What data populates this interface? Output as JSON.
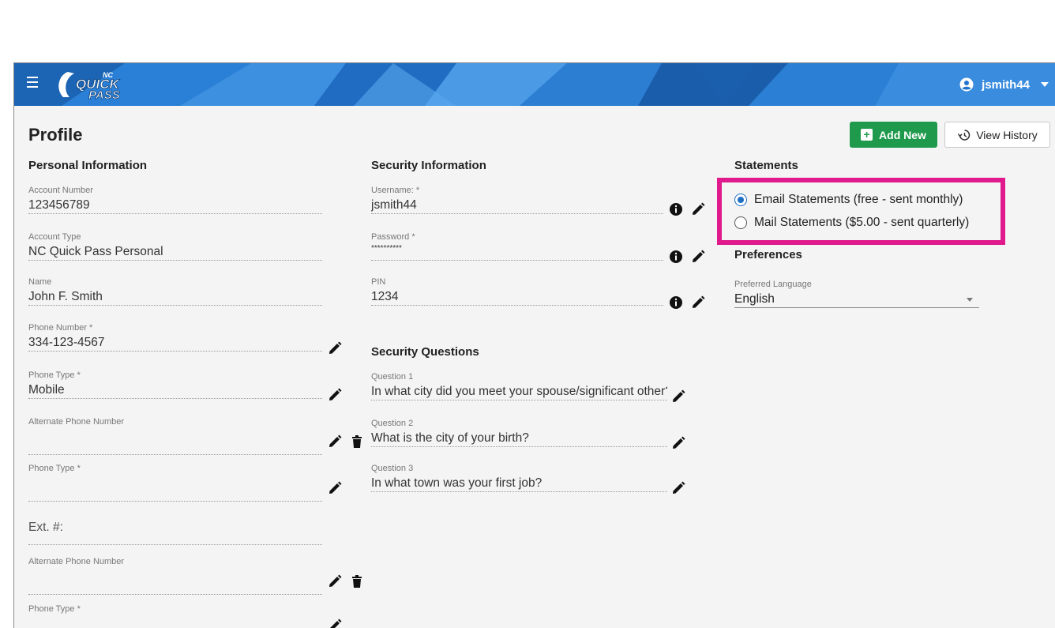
{
  "header": {
    "logo_top": "NC",
    "logo_line1": "QUICK",
    "logo_line2": "PASS",
    "username": "jsmith44"
  },
  "page": {
    "title": "Profile",
    "add_new_label": "Add New",
    "add_new_icon": "plus-box-icon",
    "view_history_label": "View History",
    "view_history_icon": "history-icon"
  },
  "personal": {
    "title": "Personal Information",
    "fields": [
      {
        "label": "Account Number",
        "value": "123456789"
      },
      {
        "label": "Account Type",
        "value": "NC Quick Pass Personal"
      },
      {
        "label": "Name",
        "value": "John F. Smith"
      },
      {
        "label": "Phone Number *",
        "value": "334-123-4567"
      },
      {
        "label": "Phone Type *",
        "value": "Mobile"
      },
      {
        "label": "Alternate Phone Number",
        "value": ""
      },
      {
        "label": "Phone Type *",
        "value": ""
      },
      {
        "label": "",
        "value": "Ext. #:"
      },
      {
        "label": "Alternate Phone Number",
        "value": ""
      },
      {
        "label": "Phone Type *",
        "value": ""
      }
    ]
  },
  "security": {
    "title": "Security Information",
    "fields": [
      {
        "label": "Username: *",
        "value": "jsmith44"
      },
      {
        "label": "Password *",
        "value": "**********"
      },
      {
        "label": "PIN",
        "value": "1234"
      }
    ],
    "questions_title": "Security Questions",
    "questions": [
      {
        "label": "Question 1",
        "value": "In what city did you meet your spouse/significant other?"
      },
      {
        "label": "Question 2",
        "value": "What is the city of your birth?"
      },
      {
        "label": "Question 3",
        "value": "In what town was your first job?"
      }
    ]
  },
  "statements": {
    "title": "Statements",
    "options": [
      {
        "label": "Email Statements (free - sent monthly)",
        "checked": true
      },
      {
        "label": "Mail Statements ($5.00 - sent quarterly)",
        "checked": false
      }
    ],
    "highlight_color": "#e0198c"
  },
  "preferences": {
    "title": "Preferences",
    "language_label": "Preferred Language",
    "language_value": "English"
  },
  "colors": {
    "brand_blue": "#1f6fc4",
    "add_green": "#1f9a4c"
  }
}
